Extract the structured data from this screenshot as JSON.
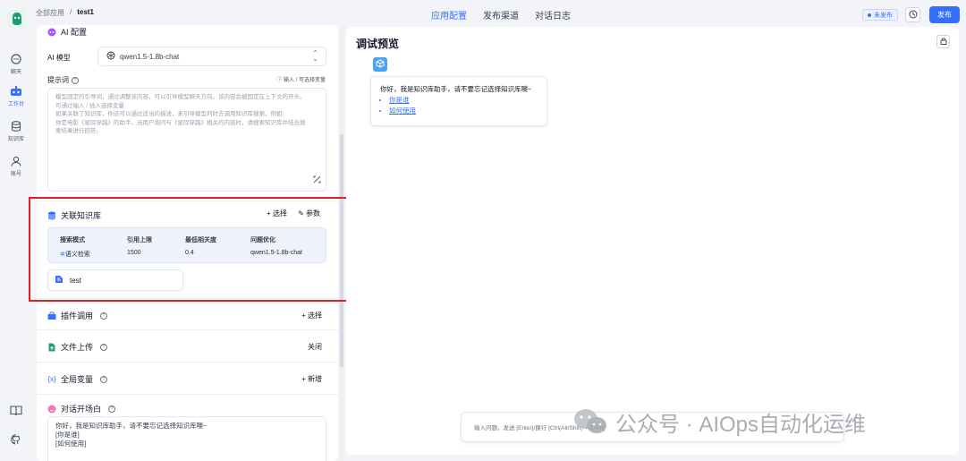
{
  "header": {
    "breadcrumb_root": "全部应用",
    "breadcrumb_sep": "/",
    "breadcrumb_current": "test1",
    "tabs": [
      {
        "label": "应用配置"
      },
      {
        "label": "发布渠道"
      },
      {
        "label": "对话日志"
      }
    ],
    "status": "未发布",
    "publish_label": "发布"
  },
  "nav": {
    "items": [
      {
        "label": "聊天"
      },
      {
        "label": "工作台"
      },
      {
        "label": "知识库"
      },
      {
        "label": "账号"
      }
    ]
  },
  "config": {
    "ai_section": "AI 配置",
    "model_label": "AI 模型",
    "model_value": "qwen1.5-1.8b-chat",
    "prompt_label": "提示词",
    "prompt_hint": "输入 / 可选择变量",
    "prompt_placeholder": [
      "模型固定的引导词，通过调整该内容，可以引导模型聊天方向。该内容会被固定在上下文的开头。",
      "可通过输入 / 插入选择变量",
      "如果关联了知识库，你还可以通过适当的描述，来引导模型何时去调用知识库搜索。例如:",
      "你是电影《星际穿越》的助手，当用户询问与《星际穿越》相关的内容时，请搜索知识库并结合搜",
      "索结果进行回答。"
    ],
    "kb_section": "关联知识库",
    "kb_select": "+ 选择",
    "kb_params": "参数",
    "kb_table": {
      "headers": [
        "搜索模式",
        "引用上限",
        "最低相关度",
        "问题优化"
      ],
      "row": [
        "语义检索",
        "1500",
        "0.4",
        "qwen1.5-1.8b-chat"
      ]
    },
    "kb_item": "test",
    "plugin_section": "插件调用",
    "plugin_action": "+ 选择",
    "upload_section": "文件上传",
    "upload_action": "关闭",
    "vars_section": "全局变量",
    "vars_action": "+ 新增",
    "opener_section": "对话开场白",
    "opener_lines": [
      "你好，我是知识库助手，请不要忘记选择知识库噢~",
      "[你是谁]",
      "[如何使用]"
    ]
  },
  "preview": {
    "title": "调试预览",
    "greeting": "你好，我是知识库助手，请不要忘记选择知识库噢~",
    "suggestions": [
      "你是谁",
      "如何使用"
    ],
    "input_placeholder": "输入问题，发送 [Enter]/换行 [Ctrl(Alt/Shift) + Enter]"
  },
  "watermark": "公众号 · AIOps自动化运维",
  "colors": {
    "accent": "#3370ff",
    "highlight": "#e11d25"
  }
}
